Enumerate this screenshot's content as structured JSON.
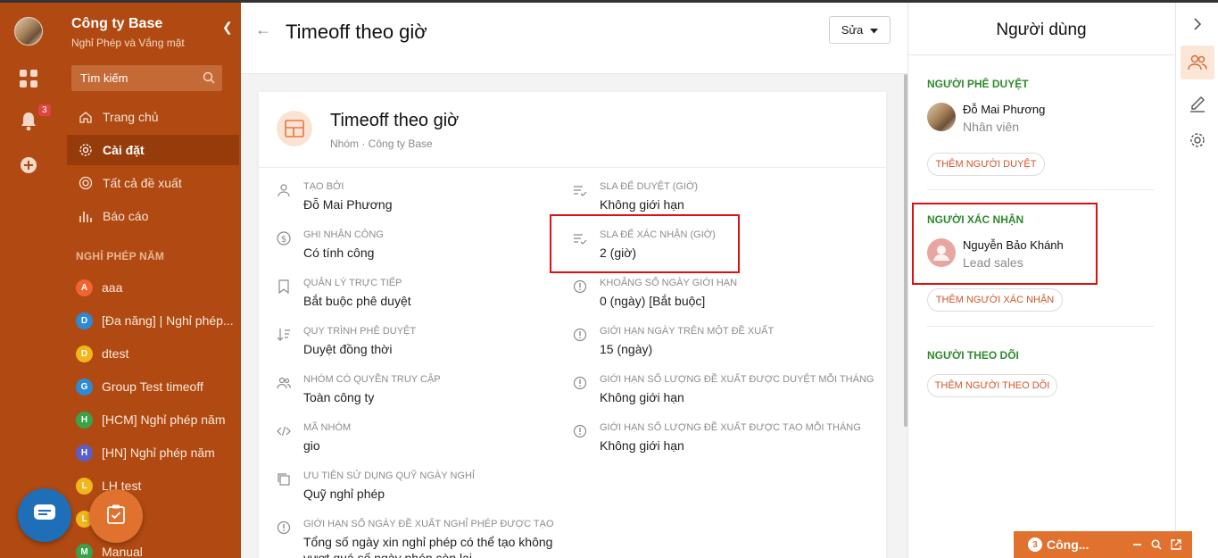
{
  "sidebar": {
    "company": "Công ty Base",
    "subtitle": "Nghỉ Phép và Vắng mặt",
    "notification_count": "3",
    "search_placeholder": "Tìm kiếm",
    "nav": [
      {
        "label": "Trang chủ",
        "icon": "home-icon"
      },
      {
        "label": "Cài đặt",
        "icon": "gear-icon",
        "active": true
      },
      {
        "label": "Tất cả đề xuất",
        "icon": "circle-icon"
      },
      {
        "label": "Báo cáo",
        "icon": "bar-chart-icon"
      }
    ],
    "section": "NGHỈ PHÉP NĂM",
    "groups": [
      {
        "letter": "A",
        "label": "aaa",
        "color": "#f0642f"
      },
      {
        "letter": "D",
        "label": "[Đa năng] | Nghỉ phép...",
        "color": "#2c8ad6"
      },
      {
        "letter": "D",
        "label": "dtest",
        "color": "#f2b51a"
      },
      {
        "letter": "G",
        "label": "Group Test timeoff",
        "color": "#2c8ad6"
      },
      {
        "letter": "H",
        "label": "[HCM] Nghỉ phép năm",
        "color": "#3aa34a"
      },
      {
        "letter": "H",
        "label": "[HN] Nghỉ phép năm",
        "color": "#5a5ec9"
      },
      {
        "letter": "L",
        "label": "LH test",
        "color": "#f2b51a"
      },
      {
        "letter": "L",
        "label": "",
        "color": "#f2b51a"
      },
      {
        "letter": "M",
        "label": "Manual",
        "color": "#3aa34a"
      }
    ]
  },
  "main": {
    "title": "Timeoff theo giờ",
    "edit_label": "Sửa",
    "card": {
      "title": "Timeoff theo giờ",
      "subtitle": "Nhóm · Công ty Base"
    },
    "fields_left": [
      {
        "label": "Tạo bởi",
        "value": "Đỗ Mai Phương",
        "icon": "user-icon"
      },
      {
        "label": "Ghi nhận công",
        "value": "Có tính công",
        "icon": "dollar-icon"
      },
      {
        "label": "Quản lý trực tiếp",
        "value": "Bắt buộc phê duyệt",
        "icon": "bookmark-icon"
      },
      {
        "label": "Quy trình phê duyệt",
        "value": "Duyệt đồng thời",
        "icon": "sort-icon"
      },
      {
        "label": "Nhóm có quyền truy cập",
        "value": "Toàn công ty",
        "icon": "users-icon"
      },
      {
        "label": "Mã nhóm",
        "value": "gio",
        "icon": "code-icon"
      },
      {
        "label": "Ưu tiên sử dụng quỹ ngày nghỉ",
        "value": "Quỹ nghỉ phép",
        "icon": "copy-icon"
      },
      {
        "label": "Giới hạn số ngày đề xuất nghỉ phép được tạo",
        "value": "Tổng số ngày xin nghỉ phép có thể tạo không vượt quá số ngày phép còn lại",
        "icon": "alert-icon"
      }
    ],
    "fields_right": [
      {
        "label": "SLA để duyệt (giờ)",
        "value": "Không giới hạn",
        "icon": "checklist-icon"
      },
      {
        "label": "SLA để xác nhận (giờ)",
        "value": "2 (giờ)",
        "icon": "checklist-icon"
      },
      {
        "label": "Khoảng số ngày giới hạn",
        "value": "0 (ngày) [Bắt buộc]",
        "icon": "alert-icon"
      },
      {
        "label": "Giới hạn ngày trên một đề xuất",
        "value": "15 (ngày)",
        "icon": "alert-icon"
      },
      {
        "label": "Giới hạn số lượng đề xuất được duyệt mỗi tháng",
        "value": "Không giới hạn",
        "icon": "alert-icon"
      },
      {
        "label": "Giới hạn số lượng đề xuất được tạo mỗi tháng",
        "value": "Không giới hạn",
        "icon": "alert-icon"
      }
    ]
  },
  "right_panel": {
    "title": "Người dùng",
    "approvers": {
      "heading": "Người phê duyệt",
      "user_name": "Đỗ Mai Phương",
      "user_role": "Nhân viên",
      "add_label": "Thêm người duyệt"
    },
    "confirmers": {
      "heading": "Người xác nhận",
      "user_name": "Nguyễn Bảo Khánh",
      "user_role": "Lead sales",
      "add_label": "Thêm người xác nhận"
    },
    "followers": {
      "heading": "Người theo dõi",
      "add_label": "Thêm người theo dõi"
    }
  },
  "chat_bar": {
    "count": "3",
    "label": "Công..."
  },
  "colors": {
    "sidebar": "#b04a12",
    "accent": "#e1712f",
    "highlight": "#e01010",
    "section_green": "#2e8b2e"
  }
}
